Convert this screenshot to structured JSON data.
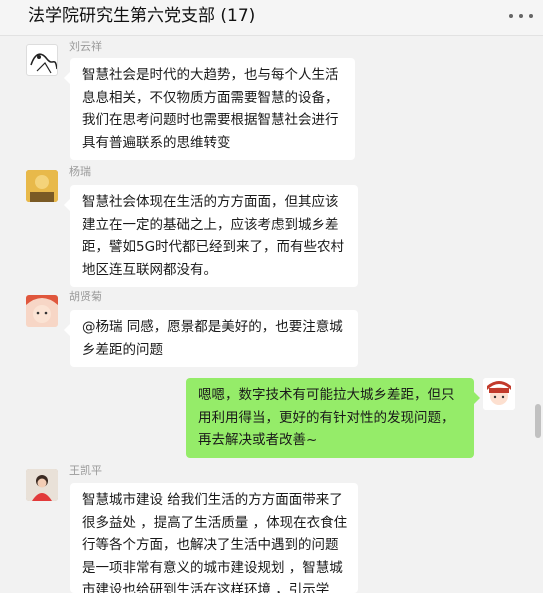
{
  "header": {
    "title": "法学院研究生第六党支部 (17)",
    "more_icon": "more-dots-icon"
  },
  "messages": [
    {
      "sender": "刘云祥",
      "avatar_icon": "sketch-avatar",
      "lines": [
        "智慧社会是时代的大趋势，也与每个人生活",
        "息息相关，不仅物质方面需要智慧的设备，",
        "我们在思考问题时也需要根据智慧社会进行",
        "具有普遍联系的思维转变"
      ]
    },
    {
      "sender": "杨瑞",
      "avatar_icon": "yellow-photo-avatar",
      "lines": [
        "智慧社会体现在生活的方方面面，但其应该",
        "建立在一定的基础之上，应该考虑到城乡差",
        "距，譬如5G时代都已经到来了，而有些农村",
        "地区连互联网都没有。"
      ]
    },
    {
      "sender": "胡贤菊",
      "avatar_icon": "cartoon-avatar",
      "lines": [
        "@杨瑞 同感，愿景都是美好的，也要注意城",
        "乡差距的问题"
      ]
    },
    {
      "sender": "",
      "avatar_icon": "cartoon-self-avatar",
      "lines": [
        "嗯嗯，数字技术有可能拉大城乡差距，但只",
        "用利用得当，更好的有针对性的发现问题，",
        "再去解决或者改善~"
      ]
    },
    {
      "sender": "王凯平",
      "avatar_icon": "photo-avatar",
      "lines": [
        "智慧城市建设 给我们生活的方方面面带来了",
        "很多益处 ，提高了生活质量 ，体现在衣食住",
        "行等各个方面，也解决了生活中遇到的问题",
        "是一项非常有意义的城市建设规划 ，智慧城",
        "市建设也给研到生活在这样环境 ，引示学"
      ]
    }
  ],
  "colors": {
    "incoming": "#ffffff",
    "outgoing": "#95ec69",
    "background": "#f2f2f2"
  }
}
